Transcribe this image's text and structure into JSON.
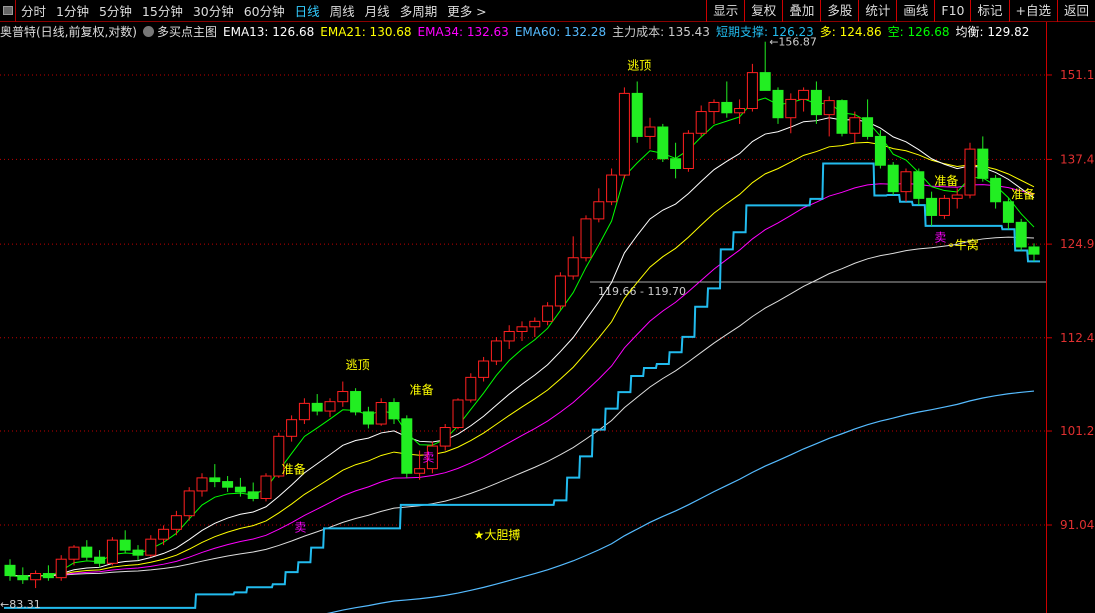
{
  "toolbar": {
    "periods": [
      "分时",
      "1分钟",
      "5分钟",
      "15分钟",
      "30分钟",
      "60分钟",
      "日线",
      "周线",
      "月线",
      "多周期",
      "更多 >"
    ],
    "active": "日线",
    "buttons": [
      "显示",
      "复权",
      "叠加",
      "多股",
      "统计",
      "画线",
      "F10",
      "标记",
      "+自选",
      "返回"
    ]
  },
  "legend": {
    "title": "奥普特(日线,前复权,对数)",
    "indicator": "多买点主图",
    "items": [
      {
        "label": "EMA13: 126.68",
        "color": "#ffffff"
      },
      {
        "label": "EMA21: 130.68",
        "color": "#ffff00"
      },
      {
        "label": "EMA34: 132.63",
        "color": "#ff00ff"
      },
      {
        "label": "EMA60: 132.28",
        "color": "#55bbff"
      },
      {
        "label": "主力成本: 135.43",
        "color": "#cccccc"
      },
      {
        "label": "短期支撑: 126.23",
        "color": "#22bbee"
      },
      {
        "label": "多: 124.86",
        "color": "#ffff00"
      },
      {
        "label": "空: 126.68",
        "color": "#00ff00"
      },
      {
        "label": "均衡: 129.82",
        "color": "#ffffff"
      }
    ]
  },
  "chart_data": {
    "type": "candlestick",
    "scale": "log",
    "ylim": [
      82,
      160
    ],
    "yticks": [
      151.1,
      137.4,
      124.9,
      112.4,
      101.2,
      91.04
    ],
    "colors": {
      "up": "#ff2020",
      "down": "#22ee22",
      "grid": "#c00000"
    },
    "high_label": "156.87",
    "low_label": "83.31",
    "hline": {
      "value": 119.68,
      "label": "119.66 - 119.70"
    },
    "ohlc": [
      [
        87,
        87.6,
        85.5,
        86
      ],
      [
        86,
        86.8,
        85.2,
        85.6
      ],
      [
        85.6,
        86.5,
        84.8,
        86.2
      ],
      [
        86.2,
        87,
        85.5,
        85.8
      ],
      [
        85.8,
        88,
        85.5,
        87.6
      ],
      [
        87.6,
        89,
        87,
        88.8
      ],
      [
        88.8,
        89.5,
        87.5,
        87.8
      ],
      [
        87.8,
        88.5,
        86.8,
        87.2
      ],
      [
        87.2,
        89.8,
        87,
        89.5
      ],
      [
        89.5,
        90.5,
        88.2,
        88.5
      ],
      [
        88.5,
        89,
        87.5,
        88
      ],
      [
        88,
        90,
        87.8,
        89.6
      ],
      [
        89.6,
        91,
        89,
        90.6
      ],
      [
        90.6,
        92.5,
        90,
        92
      ],
      [
        92,
        95,
        91.5,
        94.6
      ],
      [
        94.6,
        96.5,
        94,
        96
      ],
      [
        96,
        97.5,
        95,
        95.6
      ],
      [
        95.6,
        96.2,
        94.5,
        95
      ],
      [
        95,
        96,
        94,
        94.5
      ],
      [
        94.5,
        95.5,
        93.5,
        93.8
      ],
      [
        93.8,
        96.5,
        93.5,
        96.2
      ],
      [
        96.2,
        101,
        96,
        100.6
      ],
      [
        100.6,
        103,
        100,
        102.5
      ],
      [
        102.5,
        105,
        102,
        104.4
      ],
      [
        104.4,
        105.5,
        103,
        103.5
      ],
      [
        103.5,
        105,
        102.8,
        104.6
      ],
      [
        104.6,
        107,
        104,
        105.8
      ],
      [
        105.8,
        106.2,
        103,
        103.4
      ],
      [
        103.4,
        104,
        101.5,
        102
      ],
      [
        102,
        105,
        101.8,
        104.5
      ],
      [
        104.5,
        105,
        102,
        102.6
      ],
      [
        102.6,
        103,
        96,
        96.5
      ],
      [
        96.5,
        99,
        95.8,
        97
      ],
      [
        97,
        100,
        96.5,
        99.5
      ],
      [
        99.5,
        102,
        99,
        101.6
      ],
      [
        101.6,
        105,
        101.4,
        104.8
      ],
      [
        104.8,
        108,
        104.5,
        107.5
      ],
      [
        107.5,
        110,
        107,
        109.5
      ],
      [
        109.5,
        112.5,
        109,
        112
      ],
      [
        112,
        114,
        111,
        113.2
      ],
      [
        113.2,
        114.5,
        112,
        113.8
      ],
      [
        113.8,
        115,
        112.5,
        114.5
      ],
      [
        114.5,
        117,
        114,
        116.5
      ],
      [
        116.5,
        121,
        116,
        120.5
      ],
      [
        120.5,
        126,
        120,
        123
      ],
      [
        123,
        129,
        122.5,
        128.5
      ],
      [
        128.5,
        133,
        128,
        131
      ],
      [
        131,
        136,
        130.5,
        135
      ],
      [
        135,
        149,
        134.5,
        148
      ],
      [
        148,
        150,
        140,
        141
      ],
      [
        141,
        144,
        139,
        142.5
      ],
      [
        142.5,
        143,
        137,
        137.5
      ],
      [
        137.5,
        140,
        134.5,
        136
      ],
      [
        136,
        142,
        135.5,
        141.5
      ],
      [
        141.5,
        146,
        141,
        145
      ],
      [
        145,
        147,
        143,
        146.5
      ],
      [
        146.5,
        150,
        144,
        144.8
      ],
      [
        144.8,
        147,
        143,
        145.5
      ],
      [
        145.5,
        153,
        145,
        151.5
      ],
      [
        151.5,
        156.87,
        150,
        148.5
      ],
      [
        148.5,
        149,
        143,
        144
      ],
      [
        144,
        148,
        141.5,
        147
      ],
      [
        147,
        149,
        145,
        148.5
      ],
      [
        148.5,
        150,
        143,
        144.5
      ],
      [
        144.5,
        147.5,
        141,
        146.8
      ],
      [
        146.8,
        147,
        141,
        141.5
      ],
      [
        141.5,
        145,
        140,
        144
      ],
      [
        144,
        147,
        140.5,
        141
      ],
      [
        141,
        142,
        136,
        136.5
      ],
      [
        136.5,
        137,
        132,
        132.5
      ],
      [
        132.5,
        136,
        131,
        135.5
      ],
      [
        135.5,
        136,
        130.5,
        131.5
      ],
      [
        131.5,
        132.5,
        127.5,
        129
      ],
      [
        129,
        132,
        128.5,
        131.5
      ],
      [
        131.5,
        133,
        130,
        132
      ],
      [
        132,
        140,
        131.5,
        139
      ],
      [
        139,
        141,
        134,
        134.5
      ],
      [
        134.5,
        135,
        130,
        131
      ],
      [
        131,
        131.5,
        127,
        128
      ],
      [
        128,
        128.5,
        124,
        124.5
      ],
      [
        124.5,
        125,
        122.5,
        123.5
      ]
    ],
    "signals": [
      {
        "bar": 22,
        "price": 96.5,
        "text": "准备",
        "color": "#ffff00"
      },
      {
        "bar": 27,
        "price": 108.5,
        "text": "逃顶",
        "color": "#ffff00"
      },
      {
        "bar": 32,
        "price": 105.5,
        "text": "准备",
        "color": "#ffff00"
      },
      {
        "bar": 49,
        "price": 152,
        "text": "逃顶",
        "color": "#ffff00"
      },
      {
        "bar": 73,
        "price": 133.5,
        "text": "准备",
        "color": "#ffff00"
      },
      {
        "bar": 79,
        "price": 131.5,
        "text": "准备",
        "color": "#ffff00"
      },
      {
        "bar": 23,
        "price": 90.4,
        "text": "卖",
        "color": "#ff00ff"
      },
      {
        "bar": 33,
        "price": 97.8,
        "text": "卖",
        "color": "#ff00ff"
      },
      {
        "bar": 73,
        "price": 125.3,
        "text": "卖",
        "color": "#ff00ff"
      },
      {
        "bar": 37,
        "price": 89.6,
        "text": "★大胆搏",
        "color": "#ffff00"
      },
      {
        "bar": 74,
        "price": 124.2,
        "text": "∘牛窝",
        "color": "#ffff00"
      }
    ]
  }
}
